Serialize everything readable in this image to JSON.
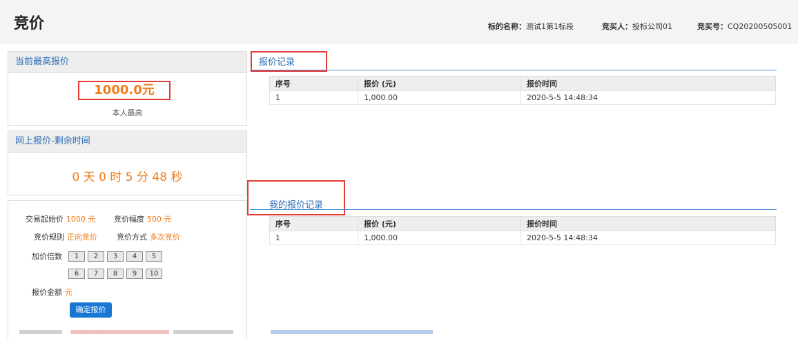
{
  "header": {
    "title": "竞价",
    "subject_label": "标的名称：",
    "subject_value": "测试1第1标段",
    "bidder_label": "竞买人：",
    "bidder_value": "投标公司01",
    "bid_no_label": "竞买号：",
    "bid_no_value": "CQ20200505001"
  },
  "highest_bid": {
    "heading": "当前最高报价",
    "amount": "1000.0元",
    "note": "本人最高"
  },
  "remaining": {
    "heading": "网上报价-剩余时间",
    "countdown": "0 天 0 时 5 分 48 秒"
  },
  "form": {
    "start_price_label": "交易起始价",
    "start_price_value": "1000 元",
    "increment_label": "竞价幅度",
    "increment_value": "500 元",
    "rule_label": "竞价规则",
    "rule_value": "正向竞价",
    "method_label": "竞价方式",
    "method_value": "多次竞价",
    "multiplier_label": "加价倍数",
    "multipliers_row1": [
      "1",
      "2",
      "3",
      "4",
      "5"
    ],
    "multipliers_row2": [
      "6",
      "7",
      "8",
      "9",
      "10"
    ],
    "amount_label": "报价金额",
    "amount_unit": "元",
    "confirm_button": "确定报价"
  },
  "bid_records": {
    "title": "报价记录",
    "columns": [
      "序号",
      "报价 (元)",
      "报价时间"
    ],
    "rows": [
      [
        "1",
        "1,000.00",
        "2020-5-5 14:48:34"
      ]
    ]
  },
  "my_records": {
    "title": "我的报价记录",
    "columns": [
      "序号",
      "报价 (元)",
      "报价时间"
    ],
    "rows": [
      [
        "1",
        "1,000.00",
        "2020-5-5 14:48:34"
      ]
    ]
  },
  "colors": {
    "accent": "#2b6cb8",
    "orange": "#f07b1a",
    "highlight": "#e53935",
    "button": "#1976d2"
  }
}
